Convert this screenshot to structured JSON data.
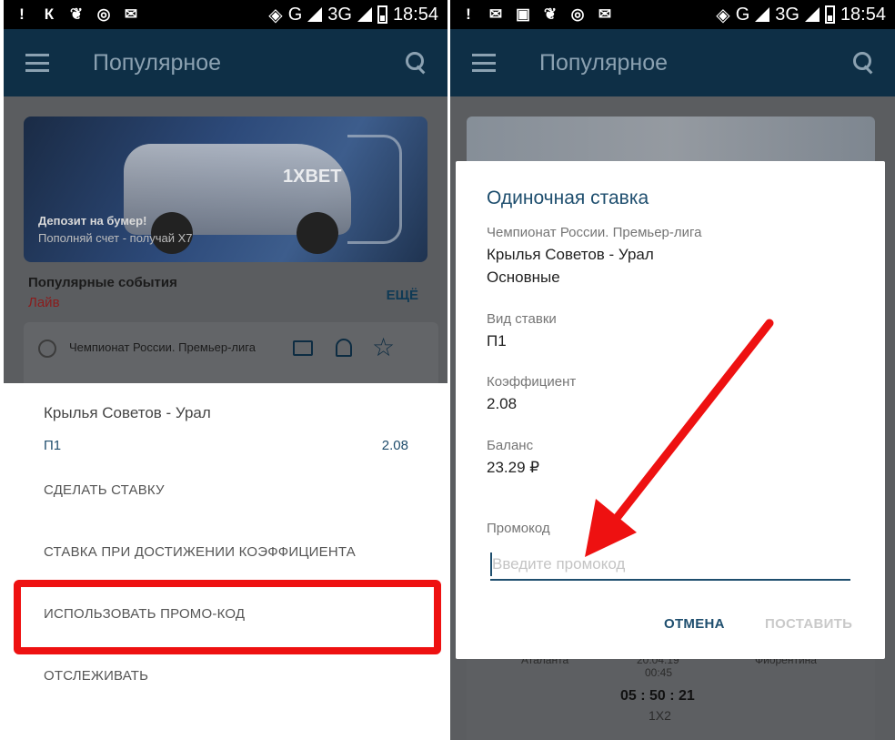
{
  "left": {
    "statusbar": {
      "time": "18:54",
      "network": "3G",
      "carrier_letter": "G",
      "app_icons": [
        "!",
        "К",
        "❦",
        "◎",
        "✉"
      ]
    },
    "appbar": {
      "title": "Популярное"
    },
    "banner": {
      "brand": "1XBET",
      "title": "Депозит на бумер!",
      "subtitle": "Пополняй счет - получай Х7"
    },
    "section": {
      "title": "Популярные события",
      "subtitle": "Лайв",
      "more": "ЕЩЁ"
    },
    "event": {
      "league": "Чемпионат России. Премьер-лига"
    },
    "sheet": {
      "match": "Крылья Советов - Урал",
      "bet_type": "П1",
      "odds": "2.08",
      "items": [
        "СДЕЛАТЬ СТАВКУ",
        "СТАВКА ПРИ ДОСТИЖЕНИИ КОЭФФИЦИЕНТА",
        "ИСПОЛЬЗОВАТЬ ПРОМО-КОД",
        "ОТСЛЕЖИВАТЬ"
      ]
    }
  },
  "right": {
    "statusbar": {
      "time": "18:54",
      "network": "3G",
      "carrier_letter": "G",
      "app_icons": [
        "!",
        "✉",
        "▣",
        "❦",
        "◎",
        "✉"
      ]
    },
    "appbar": {
      "title": "Популярное"
    },
    "background_match": {
      "team1": "Аталанта",
      "team2": "Фиорентина",
      "time_top": "20:04:19",
      "time_bottom": "00:45",
      "timer": "05 : 50 : 21",
      "market": "1X2"
    },
    "dialog": {
      "title": "Одиночная ставка",
      "league": "Чемпионат России. Премьер-лига",
      "match": "Крылья Советов - Урал",
      "market": "Основные",
      "bet_type_label": "Вид ставки",
      "bet_type_value": "П1",
      "odds_label": "Коэффициент",
      "odds_value": "2.08",
      "balance_label": "Баланс",
      "balance_value": "23.29 ₽",
      "promo_label": "Промокод",
      "promo_placeholder": "Введите промокод",
      "cancel": "ОТМЕНА",
      "place": "ПОСТАВИТЬ"
    }
  },
  "colors": {
    "appbar": "#0e2f46",
    "accent": "#1e4e6e",
    "highlight": "#ee1111",
    "live": "#8b1c1c"
  }
}
